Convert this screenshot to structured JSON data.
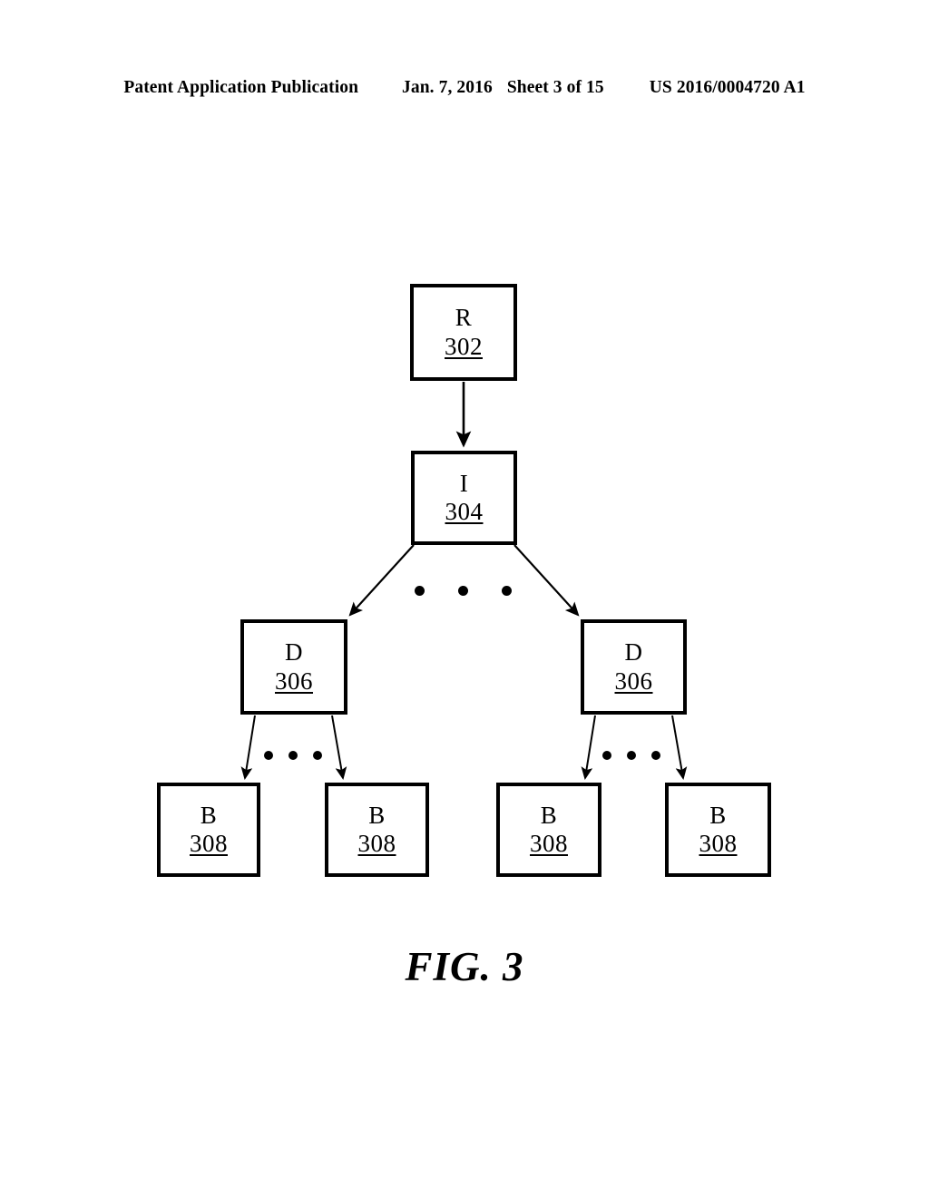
{
  "header": {
    "publication": "Patent Application Publication",
    "date": "Jan. 7, 2016",
    "sheet": "Sheet 3 of 15",
    "patent_number": "US 2016/0004720 A1"
  },
  "figure": {
    "caption": "FIG. 3",
    "line_color": "#000000",
    "background_color": "#ffffff"
  },
  "diagram": {
    "type": "hierarchical-tree",
    "nodes": [
      {
        "id": "root",
        "letter": "R",
        "ref": "302",
        "level": 0
      },
      {
        "id": "index",
        "letter": "I",
        "ref": "304",
        "level": 1
      },
      {
        "id": "dir-left",
        "letter": "D",
        "ref": "306",
        "level": 2
      },
      {
        "id": "dir-right",
        "letter": "D",
        "ref": "306",
        "level": 2
      },
      {
        "id": "block-1",
        "letter": "B",
        "ref": "308",
        "level": 3
      },
      {
        "id": "block-2",
        "letter": "B",
        "ref": "308",
        "level": 3
      },
      {
        "id": "block-3",
        "letter": "B",
        "ref": "308",
        "level": 3
      },
      {
        "id": "block-4",
        "letter": "B",
        "ref": "308",
        "level": 3
      }
    ],
    "edges": [
      {
        "from": "root",
        "to": "index"
      },
      {
        "from": "index",
        "to": "dir-left"
      },
      {
        "from": "index",
        "to": "dir-right"
      },
      {
        "from": "dir-left",
        "to": "block-1"
      },
      {
        "from": "dir-left",
        "to": "block-2"
      },
      {
        "from": "dir-right",
        "to": "block-3"
      },
      {
        "from": "dir-right",
        "to": "block-4"
      }
    ],
    "ellipses": [
      {
        "id": "ellipsis-directories",
        "dots": 3,
        "between": "dir-left / dir-right"
      },
      {
        "id": "ellipsis-blocks-left",
        "dots": 3,
        "between": "block-1 / block-2"
      },
      {
        "id": "ellipsis-blocks-right",
        "dots": 3,
        "between": "block-3 / block-4"
      }
    ]
  }
}
